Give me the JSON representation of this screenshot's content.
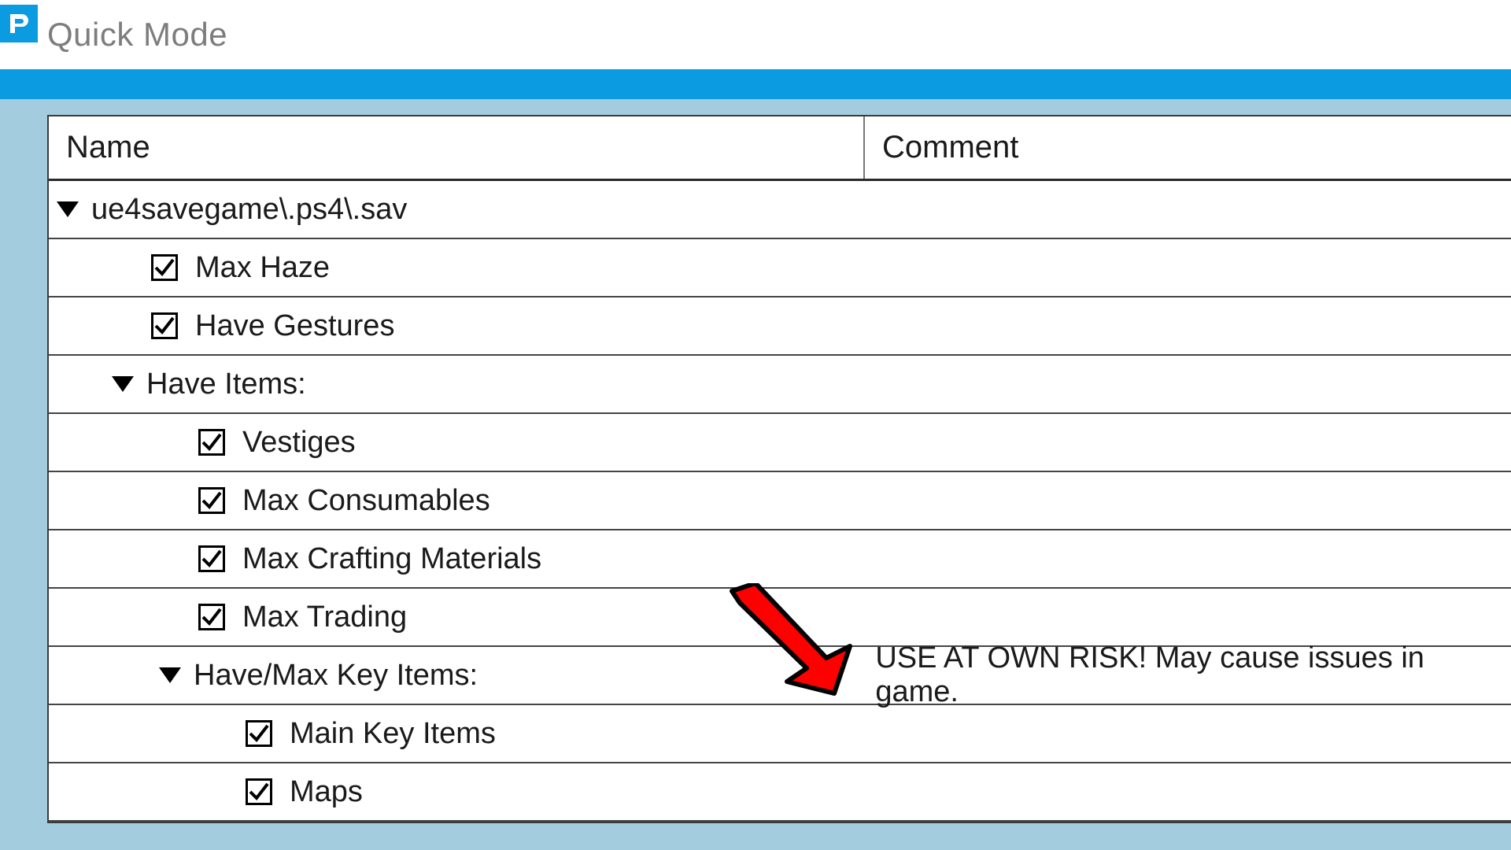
{
  "window": {
    "title": "Quick Mode"
  },
  "headers": {
    "name": "Name",
    "comment": "Comment"
  },
  "root": {
    "label": "ue4savegame\\.ps4\\.sav"
  },
  "items": {
    "maxHaze": {
      "label": "Max Haze",
      "checked": true
    },
    "haveGestures": {
      "label": "Have Gestures",
      "checked": true
    },
    "haveItems": {
      "label": "Have Items:"
    },
    "vestiges": {
      "label": "Vestiges",
      "checked": true
    },
    "maxConsumables": {
      "label": "Max Consumables",
      "checked": true
    },
    "maxCrafting": {
      "label": "Max Crafting Materials",
      "checked": true
    },
    "maxTrading": {
      "label": "Max Trading",
      "checked": true
    },
    "keyItems": {
      "label": "Have/Max Key Items:",
      "comment": "USE AT OWN RISK! May cause issues in game."
    },
    "mainKeyItems": {
      "label": "Main Key Items",
      "checked": true
    },
    "maps": {
      "label": "Maps",
      "checked": true
    }
  }
}
